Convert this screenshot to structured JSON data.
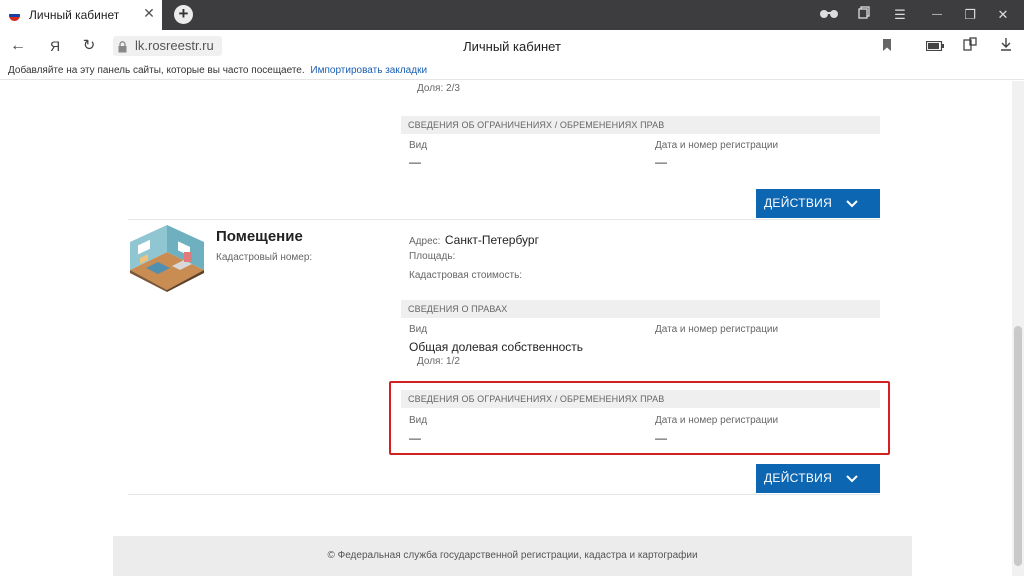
{
  "browser": {
    "tab_title": "Личный кабинет",
    "close_glyph": "✕",
    "newtab_glyph": "+",
    "url": "lk.rosreestr.ru",
    "page_title": "Личный кабинет",
    "yandex_glyph": "Я",
    "bookmarks_hint": "Добавляйте на эту панель сайты, которые вы часто посещаете.",
    "bookmarks_link": "Импортировать закладки",
    "window_controls": {
      "menu": "☰",
      "minimize": "—",
      "restore": "❐",
      "close": "✕"
    }
  },
  "property_top": {
    "share_label": "Доля: 2/3",
    "restrictions_header": "СВЕДЕНИЯ ОБ ОГРАНИЧЕНИЯХ / ОБРЕМЕНЕНИЯХ ПРАВ",
    "kind_label": "Вид",
    "reg_label": "Дата и номер регистрации",
    "kind_value": "—",
    "reg_value": "—",
    "actions_label": "ДЕЙСТВИЯ"
  },
  "property_room": {
    "title": "Помещение",
    "cadastral_label": "Кадастровый номер:",
    "address_label": "Адрес:",
    "address_value": "Санкт-Петербург",
    "area_label": "Площадь:",
    "cost_label": "Кадастровая стоимость:",
    "rights_header": "СВЕДЕНИЯ О ПРАВАХ",
    "kind_label": "Вид",
    "reg_label": "Дата и номер регистрации",
    "rights_kind_value": "Общая долевая собственность",
    "share_label": "Доля: 1/2",
    "restrictions_header": "СВЕДЕНИЯ ОБ ОГРАНИЧЕНИЯХ / ОБРЕМЕНЕНИЯХ ПРАВ",
    "restr_kind_label": "Вид",
    "restr_reg_label": "Дата и номер регистрации",
    "restr_kind_value": "—",
    "restr_reg_value": "—",
    "actions_label": "ДЕЙСТВИЯ"
  },
  "footer": {
    "text": "© Федеральная служба государственной регистрации, кадастра и картографии"
  },
  "colors": {
    "primary_button": "#0d66b2",
    "highlight_border": "#d32020",
    "tab_bar": "#3d3d3f"
  }
}
